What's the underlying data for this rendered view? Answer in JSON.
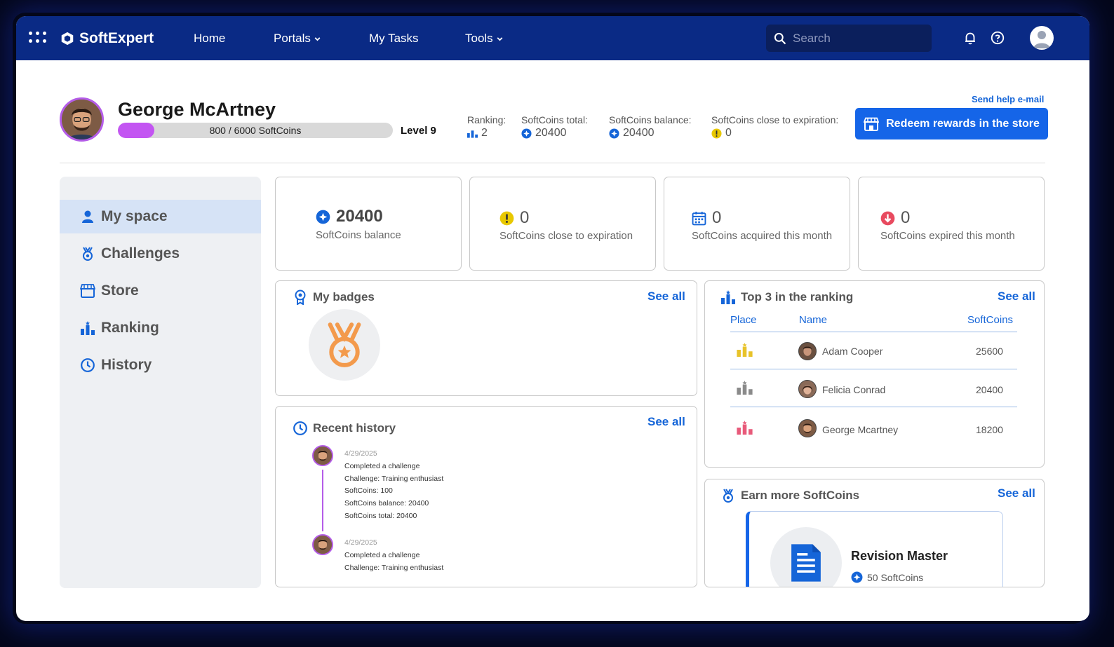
{
  "topbar": {
    "brand": "SoftExpert",
    "nav": [
      {
        "label": "Home"
      },
      {
        "label": "Portals"
      },
      {
        "label": "My Tasks"
      },
      {
        "label": "Tools"
      }
    ],
    "search_placeholder": "Search"
  },
  "profile": {
    "name": "George McArtney",
    "progress_text": "800 / 6000 SoftCoins",
    "progress_fraction": 0.133,
    "level": "Level 9",
    "stats": [
      {
        "label": "Ranking:",
        "value": "2",
        "icon": "ranking-icon"
      },
      {
        "label": "SoftCoins total:",
        "value": "20400",
        "icon": "softcoin-icon"
      },
      {
        "label": "SoftCoins balance:",
        "value": "20400",
        "icon": "softcoin-icon"
      },
      {
        "label": "SoftCoins close to expiration:",
        "value": "0",
        "icon": "warning-icon"
      }
    ],
    "send_help": "Send help e-mail",
    "redeem": "Redeem rewards in the store"
  },
  "sidebar": {
    "items": [
      {
        "label": "My space",
        "icon": "user-icon",
        "active": true
      },
      {
        "label": "Challenges",
        "icon": "medal-icon"
      },
      {
        "label": "Store",
        "icon": "store-icon"
      },
      {
        "label": "Ranking",
        "icon": "ranking-icon"
      },
      {
        "label": "History",
        "icon": "clock-icon"
      }
    ]
  },
  "kpis": [
    {
      "value": "20400",
      "label": "SoftCoins balance",
      "icon": "softcoin-icon"
    },
    {
      "value": "0",
      "label": "SoftCoins close to expiration",
      "icon": "warning-icon"
    },
    {
      "value": "0",
      "label": "SoftCoins acquired this month",
      "icon": "calendar-icon"
    },
    {
      "value": "0",
      "label": "SoftCoins expired this month",
      "icon": "expired-icon"
    }
  ],
  "badges": {
    "title": "My badges",
    "see_all": "See all"
  },
  "ranking": {
    "title": "Top 3 in the ranking",
    "see_all": "See all",
    "columns": [
      "Place",
      "Name",
      "SoftCoins"
    ],
    "rows": [
      {
        "name": "Adam Cooper",
        "coins": "25600",
        "color": "#e8c32a"
      },
      {
        "name": "Felicia Conrad",
        "coins": "20400",
        "color": "#8a8a8a"
      },
      {
        "name": "George Mcartney",
        "coins": "18200",
        "color": "#e85a7a"
      }
    ]
  },
  "history": {
    "title": "Recent history",
    "see_all": "See all",
    "entries": [
      {
        "date": "4/29/2025",
        "lines": [
          "Completed a challenge",
          "Challenge: Training enthusiast",
          "SoftCoins: 100",
          "SoftCoins balance: 20400",
          "SoftCoins total: 20400"
        ]
      },
      {
        "date": "4/29/2025",
        "lines": [
          "Completed a challenge",
          "Challenge: Training enthusiast"
        ]
      }
    ]
  },
  "earn": {
    "title": "Earn more SoftCoins",
    "see_all": "See all",
    "challenge_name": "Revision Master",
    "challenge_reward": "50 SoftCoins"
  },
  "colors": {
    "nav_bg": "#0a2a85",
    "accent": "#1565e8",
    "progress": "#c355f2",
    "badge_orange": "#f39a4c"
  }
}
